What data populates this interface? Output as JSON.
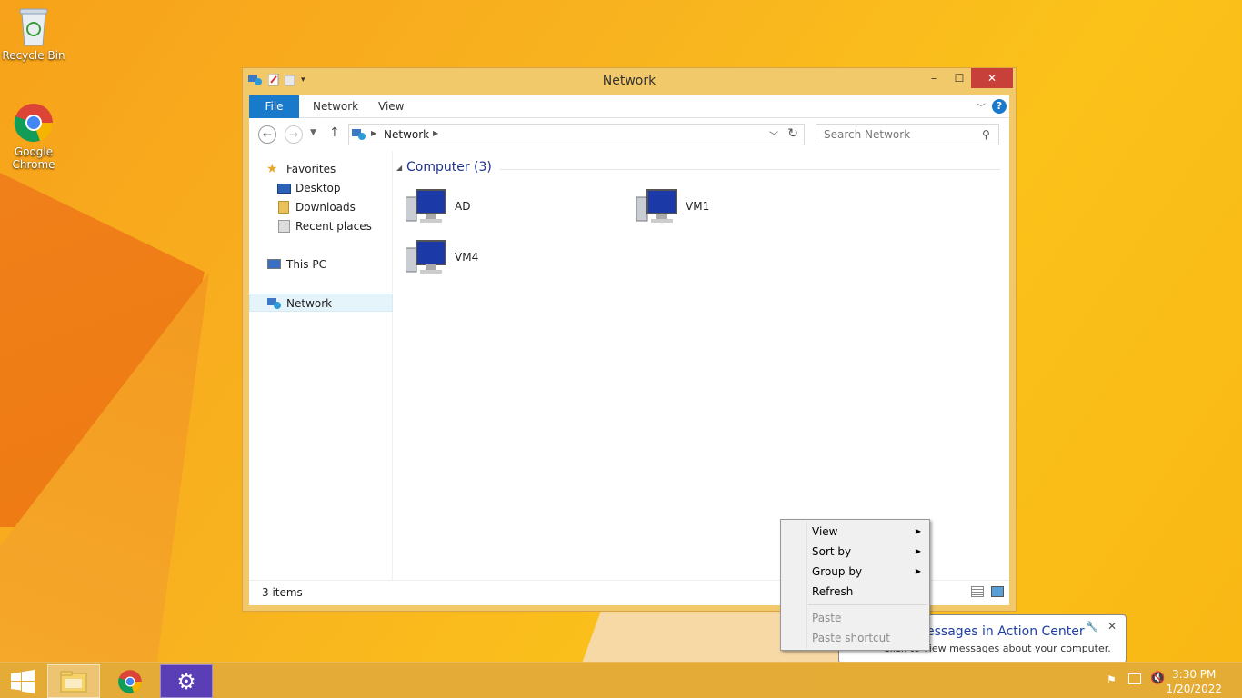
{
  "desktop": {
    "icons": [
      {
        "label": "Recycle Bin"
      },
      {
        "label": "Google Chrome"
      }
    ]
  },
  "window": {
    "title": "Network",
    "minimize": "–",
    "maximize": "☐",
    "close": "✕",
    "ribbon_tabs": [
      "File",
      "Network",
      "View"
    ],
    "address": {
      "crumb": "Network"
    },
    "search": {
      "placeholder": "Search Network"
    },
    "nav_pane": {
      "favorites": "Favorites",
      "desktop": "Desktop",
      "downloads": "Downloads",
      "recent": "Recent places",
      "this_pc": "This PC",
      "network": "Network"
    },
    "content": {
      "group_header": "Computer (3)",
      "items": [
        "AD",
        "VM1",
        "VM4"
      ]
    },
    "status": "3 items"
  },
  "context_menu": {
    "items": [
      {
        "label": "View",
        "submenu": true,
        "disabled": false
      },
      {
        "label": "Sort by",
        "submenu": true,
        "disabled": false
      },
      {
        "label": "Group by",
        "submenu": true,
        "disabled": false
      },
      {
        "label": "Refresh",
        "submenu": false,
        "disabled": false
      },
      {
        "label": "Paste",
        "submenu": false,
        "disabled": true
      },
      {
        "label": "Paste shortcut",
        "submenu": false,
        "disabled": true
      }
    ]
  },
  "balloon": {
    "title": "essages in Action Center",
    "body": "Click to view messages about your computer."
  },
  "taskbar": {
    "time": "3:30 PM",
    "date": "1/20/2022"
  }
}
